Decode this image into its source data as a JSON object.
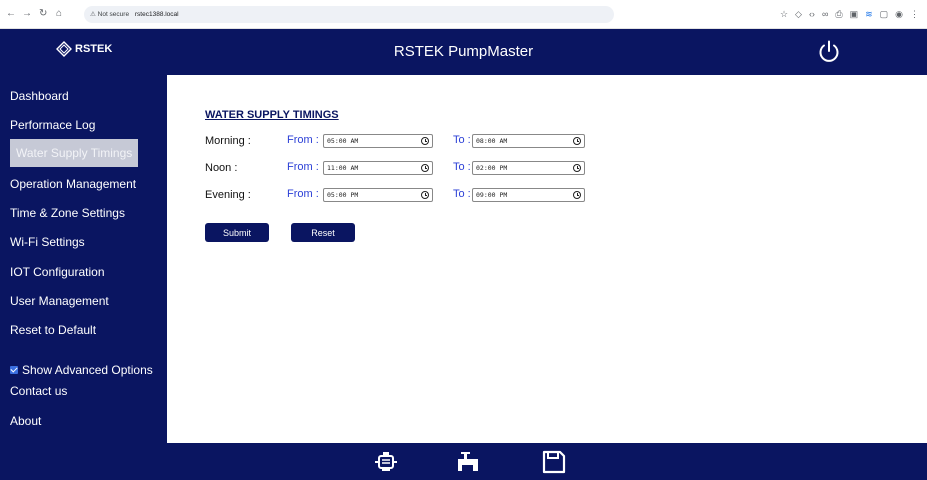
{
  "browser": {
    "security_label": "Not secure",
    "url": "rstec1388.local"
  },
  "header": {
    "logo_text": "RSTEK",
    "title": "RSTEK PumpMaster",
    "power_icon": "power-icon"
  },
  "sidebar": {
    "items": [
      {
        "label": "Dashboard"
      },
      {
        "label": "Performace Log"
      },
      {
        "label": "Water Supply Timings",
        "active": true
      },
      {
        "label": "Operation Management"
      },
      {
        "label": "Time & Zone Settings"
      },
      {
        "label": "Wi-Fi Settings"
      },
      {
        "label": "IOT Configuration"
      },
      {
        "label": "User Management"
      },
      {
        "label": "Reset to Default"
      }
    ],
    "advanced_label": "Show Advanced Options",
    "advanced_checked": true,
    "extra_items": [
      {
        "label": "Contact us"
      },
      {
        "label": "About"
      }
    ]
  },
  "main": {
    "section_title": "WATER SUPPLY TIMINGS",
    "from_label": "From :",
    "to_label": "To :",
    "rows": [
      {
        "label": "Morning :",
        "from": "05:00 AM",
        "to": "08:00 AM"
      },
      {
        "label": "Noon :",
        "from": "11:00 AM",
        "to": "02:00 PM"
      },
      {
        "label": "Evening :",
        "from": "05:00 PM",
        "to": "09:00 PM"
      }
    ],
    "submit_label": "Submit",
    "reset_label": "Reset"
  },
  "footer": {
    "icons": [
      "pump-icon",
      "tap-icon",
      "save-icon"
    ]
  },
  "colors": {
    "brand": "#0a1561",
    "active_item": "#c6c9d6",
    "from_to_label": "#2b3fd6"
  }
}
